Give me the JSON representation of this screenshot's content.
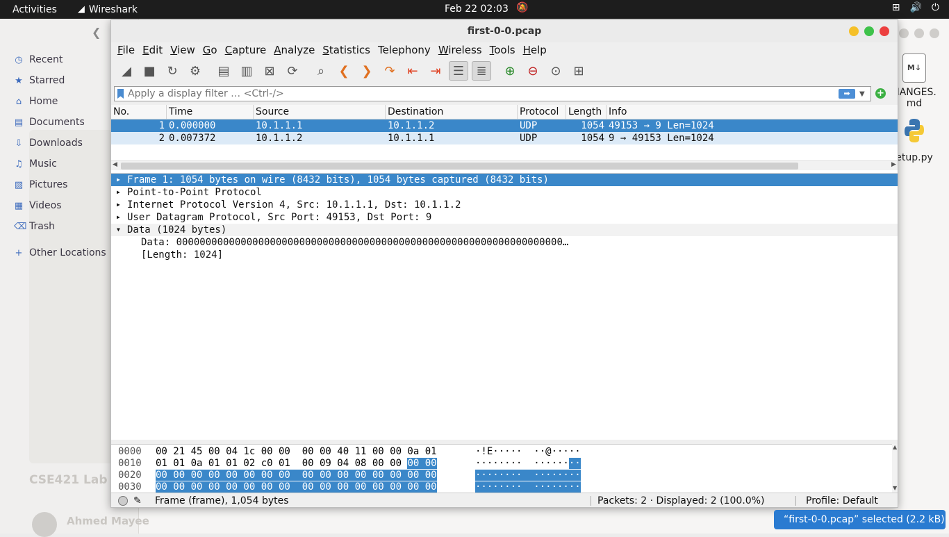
{
  "topbar": {
    "activities": "Activities",
    "app_name": "Wireshark",
    "clock": "Feb 22  02:03",
    "icons": [
      "network-icon",
      "volume-icon",
      "power-icon"
    ]
  },
  "file_manager": {
    "sidebar": [
      {
        "label": "Recent",
        "icon": "clock-icon"
      },
      {
        "label": "Starred",
        "icon": "star-icon"
      },
      {
        "label": "Home",
        "icon": "home-icon"
      },
      {
        "label": "Documents",
        "icon": "document-icon"
      },
      {
        "label": "Downloads",
        "icon": "download-icon"
      },
      {
        "label": "Music",
        "icon": "music-icon"
      },
      {
        "label": "Pictures",
        "icon": "picture-icon"
      },
      {
        "label": "Videos",
        "icon": "video-icon"
      },
      {
        "label": "Trash",
        "icon": "trash-icon"
      },
      {
        "label": "Other Locations",
        "icon": "plus-icon"
      }
    ],
    "background_title": "CSE421 Lab",
    "background_author": "Ahmed Mayee",
    "desktop_files": [
      {
        "name_line1": "HANGES.",
        "name_line2": "md",
        "icon_text": "M↓"
      },
      {
        "name_line1": "etup.py",
        "name_line2": ""
      }
    ]
  },
  "window": {
    "title": "first-0-0.pcap",
    "menu": [
      {
        "u": "F",
        "rest": "ile"
      },
      {
        "u": "E",
        "rest": "dit"
      },
      {
        "u": "V",
        "rest": "iew"
      },
      {
        "u": "G",
        "rest": "o"
      },
      {
        "u": "C",
        "rest": "apture"
      },
      {
        "u": "A",
        "rest": "nalyze"
      },
      {
        "u": "S",
        "rest": "tatistics"
      },
      {
        "u": "",
        "rest": "Telephony"
      },
      {
        "u": "W",
        "rest": "ireless"
      },
      {
        "u": "T",
        "rest": "ools"
      },
      {
        "u": "H",
        "rest": "elp"
      }
    ],
    "filter": {
      "placeholder": "Apply a display filter … <Ctrl-/>",
      "value": ""
    },
    "packet_list": {
      "columns": [
        "No.",
        "Time",
        "Source",
        "Destination",
        "Protocol",
        "Length",
        "Info"
      ],
      "rows": [
        {
          "no": "1",
          "time": "0.000000",
          "src": "10.1.1.1",
          "dst": "10.1.1.2",
          "proto": "UDP",
          "len": "1054",
          "info": "49153 → 9 Len=1024"
        },
        {
          "no": "2",
          "time": "0.007372",
          "src": "10.1.1.2",
          "dst": "10.1.1.1",
          "proto": "UDP",
          "len": "1054",
          "info": "9 → 49153 Len=1024"
        }
      ]
    },
    "details": {
      "frame": "Frame 1: 1054 bytes on wire (8432 bits), 1054 bytes captured (8432 bits)",
      "ppp": "Point-to-Point Protocol",
      "ip": "Internet Protocol Version 4, Src: 10.1.1.1, Dst: 10.1.1.2",
      "udp": "User Datagram Protocol, Src Port: 49153, Dst Port: 9",
      "data": "Data (1024 bytes)",
      "data_value": "Data: 000000000000000000000000000000000000000000000000000000000000000000…",
      "data_length": "[Length: 1024]"
    },
    "bytes": [
      {
        "offset": "0000",
        "hex_a": "00 21 45 00 04 1c 00 00  00 00 40 11 00 00 0a 01",
        "hex_b": "",
        "ascii_a": "·!E·····  ··@·····",
        "ascii_b": ""
      },
      {
        "offset": "0010",
        "hex_a": "01 01 0a 01 01 02 c0 01  00 09 04 08 00 00 ",
        "hex_b": "00 00",
        "ascii_a": "········  ······",
        "ascii_b": "··"
      },
      {
        "offset": "0020",
        "hex_a": "",
        "hex_b": "00 00 00 00 00 00 00 00  00 00 00 00 00 00 00 00",
        "ascii_a": "",
        "ascii_b": "········  ········"
      },
      {
        "offset": "0030",
        "hex_a": "",
        "hex_b": "00 00 00 00 00 00 00 00  00 00 00 00 00 00 00 00",
        "ascii_a": "",
        "ascii_b": "········  ········"
      }
    ],
    "status": {
      "field": "Frame (frame), 1,054 bytes",
      "packets": "Packets: 2 · Displayed: 2 (100.0%)",
      "profile": "Profile: Default"
    }
  },
  "notification": "“first-0-0.pcap” selected  (2.2 kB)",
  "colors": {
    "selection": "#3a87c9",
    "alt_row": "#dceaf7",
    "topbar": "#1d1d1d",
    "notification": "#2a7bd1"
  }
}
